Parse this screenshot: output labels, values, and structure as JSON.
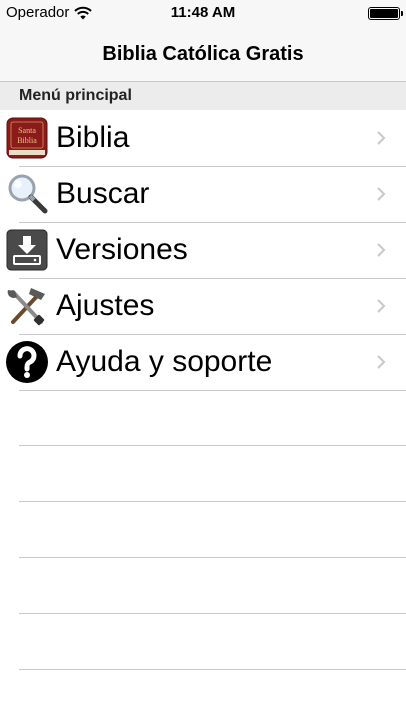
{
  "status_bar": {
    "carrier": "Operador",
    "time": "11:48 AM"
  },
  "nav": {
    "title": "Biblia Católica Gratis"
  },
  "section": {
    "header": "Menú principal"
  },
  "menu": {
    "items": [
      {
        "label": "Biblia",
        "icon": "bible-book-icon"
      },
      {
        "label": "Buscar",
        "icon": "magnifier-icon"
      },
      {
        "label": "Versiones",
        "icon": "download-icon"
      },
      {
        "label": "Ajustes",
        "icon": "tools-icon"
      },
      {
        "label": "Ayuda y soporte",
        "icon": "help-icon"
      }
    ]
  },
  "book_cover": {
    "line1": "Santa",
    "line2": "Biblia"
  },
  "colors": {
    "bar_background": "#f7f7f7",
    "separator": "#c8c7cc",
    "section_background": "#ececec",
    "chevron": "#c7c7cc",
    "bible_cover": "#8b1a1a"
  }
}
